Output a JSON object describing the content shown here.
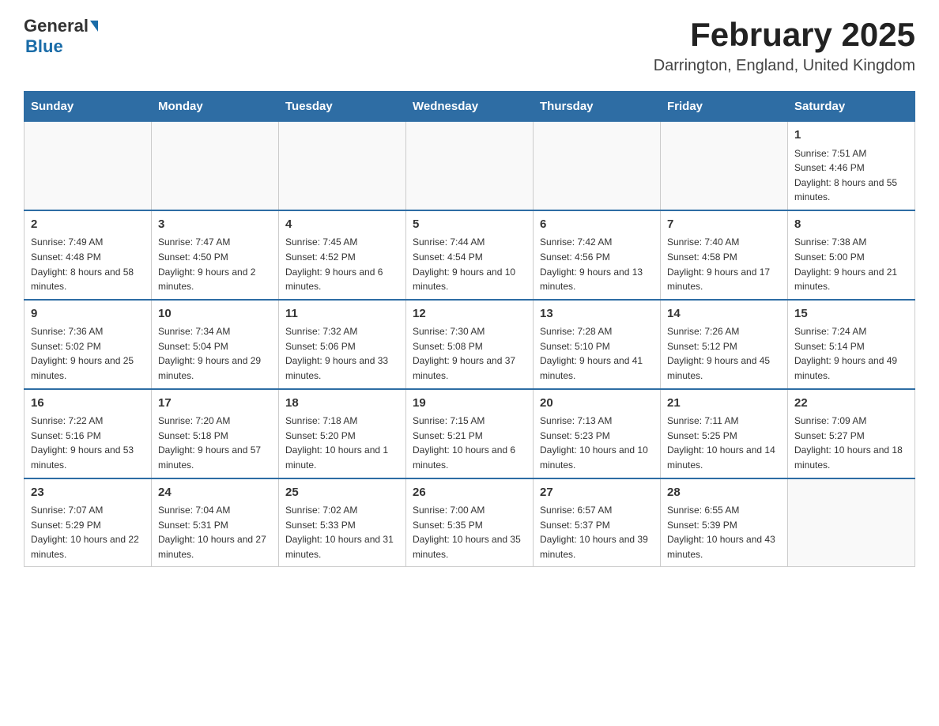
{
  "header": {
    "logo_general": "General",
    "logo_blue": "Blue",
    "month_title": "February 2025",
    "location": "Darrington, England, United Kingdom"
  },
  "weekdays": [
    "Sunday",
    "Monday",
    "Tuesday",
    "Wednesday",
    "Thursday",
    "Friday",
    "Saturday"
  ],
  "weeks": [
    [
      {
        "day": "",
        "sunrise": "",
        "sunset": "",
        "daylight": ""
      },
      {
        "day": "",
        "sunrise": "",
        "sunset": "",
        "daylight": ""
      },
      {
        "day": "",
        "sunrise": "",
        "sunset": "",
        "daylight": ""
      },
      {
        "day": "",
        "sunrise": "",
        "sunset": "",
        "daylight": ""
      },
      {
        "day": "",
        "sunrise": "",
        "sunset": "",
        "daylight": ""
      },
      {
        "day": "",
        "sunrise": "",
        "sunset": "",
        "daylight": ""
      },
      {
        "day": "1",
        "sunrise": "Sunrise: 7:51 AM",
        "sunset": "Sunset: 4:46 PM",
        "daylight": "Daylight: 8 hours and 55 minutes."
      }
    ],
    [
      {
        "day": "2",
        "sunrise": "Sunrise: 7:49 AM",
        "sunset": "Sunset: 4:48 PM",
        "daylight": "Daylight: 8 hours and 58 minutes."
      },
      {
        "day": "3",
        "sunrise": "Sunrise: 7:47 AM",
        "sunset": "Sunset: 4:50 PM",
        "daylight": "Daylight: 9 hours and 2 minutes."
      },
      {
        "day": "4",
        "sunrise": "Sunrise: 7:45 AM",
        "sunset": "Sunset: 4:52 PM",
        "daylight": "Daylight: 9 hours and 6 minutes."
      },
      {
        "day": "5",
        "sunrise": "Sunrise: 7:44 AM",
        "sunset": "Sunset: 4:54 PM",
        "daylight": "Daylight: 9 hours and 10 minutes."
      },
      {
        "day": "6",
        "sunrise": "Sunrise: 7:42 AM",
        "sunset": "Sunset: 4:56 PM",
        "daylight": "Daylight: 9 hours and 13 minutes."
      },
      {
        "day": "7",
        "sunrise": "Sunrise: 7:40 AM",
        "sunset": "Sunset: 4:58 PM",
        "daylight": "Daylight: 9 hours and 17 minutes."
      },
      {
        "day": "8",
        "sunrise": "Sunrise: 7:38 AM",
        "sunset": "Sunset: 5:00 PM",
        "daylight": "Daylight: 9 hours and 21 minutes."
      }
    ],
    [
      {
        "day": "9",
        "sunrise": "Sunrise: 7:36 AM",
        "sunset": "Sunset: 5:02 PM",
        "daylight": "Daylight: 9 hours and 25 minutes."
      },
      {
        "day": "10",
        "sunrise": "Sunrise: 7:34 AM",
        "sunset": "Sunset: 5:04 PM",
        "daylight": "Daylight: 9 hours and 29 minutes."
      },
      {
        "day": "11",
        "sunrise": "Sunrise: 7:32 AM",
        "sunset": "Sunset: 5:06 PM",
        "daylight": "Daylight: 9 hours and 33 minutes."
      },
      {
        "day": "12",
        "sunrise": "Sunrise: 7:30 AM",
        "sunset": "Sunset: 5:08 PM",
        "daylight": "Daylight: 9 hours and 37 minutes."
      },
      {
        "day": "13",
        "sunrise": "Sunrise: 7:28 AM",
        "sunset": "Sunset: 5:10 PM",
        "daylight": "Daylight: 9 hours and 41 minutes."
      },
      {
        "day": "14",
        "sunrise": "Sunrise: 7:26 AM",
        "sunset": "Sunset: 5:12 PM",
        "daylight": "Daylight: 9 hours and 45 minutes."
      },
      {
        "day": "15",
        "sunrise": "Sunrise: 7:24 AM",
        "sunset": "Sunset: 5:14 PM",
        "daylight": "Daylight: 9 hours and 49 minutes."
      }
    ],
    [
      {
        "day": "16",
        "sunrise": "Sunrise: 7:22 AM",
        "sunset": "Sunset: 5:16 PM",
        "daylight": "Daylight: 9 hours and 53 minutes."
      },
      {
        "day": "17",
        "sunrise": "Sunrise: 7:20 AM",
        "sunset": "Sunset: 5:18 PM",
        "daylight": "Daylight: 9 hours and 57 minutes."
      },
      {
        "day": "18",
        "sunrise": "Sunrise: 7:18 AM",
        "sunset": "Sunset: 5:20 PM",
        "daylight": "Daylight: 10 hours and 1 minute."
      },
      {
        "day": "19",
        "sunrise": "Sunrise: 7:15 AM",
        "sunset": "Sunset: 5:21 PM",
        "daylight": "Daylight: 10 hours and 6 minutes."
      },
      {
        "day": "20",
        "sunrise": "Sunrise: 7:13 AM",
        "sunset": "Sunset: 5:23 PM",
        "daylight": "Daylight: 10 hours and 10 minutes."
      },
      {
        "day": "21",
        "sunrise": "Sunrise: 7:11 AM",
        "sunset": "Sunset: 5:25 PM",
        "daylight": "Daylight: 10 hours and 14 minutes."
      },
      {
        "day": "22",
        "sunrise": "Sunrise: 7:09 AM",
        "sunset": "Sunset: 5:27 PM",
        "daylight": "Daylight: 10 hours and 18 minutes."
      }
    ],
    [
      {
        "day": "23",
        "sunrise": "Sunrise: 7:07 AM",
        "sunset": "Sunset: 5:29 PM",
        "daylight": "Daylight: 10 hours and 22 minutes."
      },
      {
        "day": "24",
        "sunrise": "Sunrise: 7:04 AM",
        "sunset": "Sunset: 5:31 PM",
        "daylight": "Daylight: 10 hours and 27 minutes."
      },
      {
        "day": "25",
        "sunrise": "Sunrise: 7:02 AM",
        "sunset": "Sunset: 5:33 PM",
        "daylight": "Daylight: 10 hours and 31 minutes."
      },
      {
        "day": "26",
        "sunrise": "Sunrise: 7:00 AM",
        "sunset": "Sunset: 5:35 PM",
        "daylight": "Daylight: 10 hours and 35 minutes."
      },
      {
        "day": "27",
        "sunrise": "Sunrise: 6:57 AM",
        "sunset": "Sunset: 5:37 PM",
        "daylight": "Daylight: 10 hours and 39 minutes."
      },
      {
        "day": "28",
        "sunrise": "Sunrise: 6:55 AM",
        "sunset": "Sunset: 5:39 PM",
        "daylight": "Daylight: 10 hours and 43 minutes."
      },
      {
        "day": "",
        "sunrise": "",
        "sunset": "",
        "daylight": ""
      }
    ]
  ]
}
